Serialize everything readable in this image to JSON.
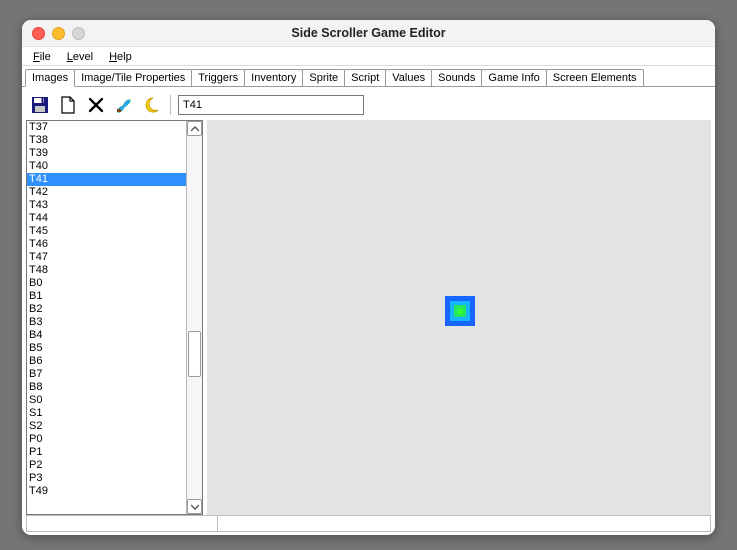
{
  "window": {
    "title": "Side Scroller Game Editor"
  },
  "menubar": {
    "items": [
      "File",
      "Level",
      "Help"
    ]
  },
  "tabs": {
    "items": [
      "Images",
      "Image/Tile Properties",
      "Triggers",
      "Inventory",
      "Sprite",
      "Script",
      "Values",
      "Sounds",
      "Game Info",
      "Screen Elements"
    ],
    "active_index": 0
  },
  "toolbar": {
    "name_field_value": "T41",
    "icons": [
      "save-icon",
      "new-icon",
      "delete-icon",
      "brush-icon",
      "moon-icon"
    ]
  },
  "list": {
    "selected": "T41",
    "items": [
      "T37",
      "T38",
      "T39",
      "T40",
      "T41",
      "T42",
      "T43",
      "T44",
      "T45",
      "T46",
      "T47",
      "T48",
      "B0",
      "B1",
      "B2",
      "B3",
      "B4",
      "B5",
      "B6",
      "B7",
      "B8",
      "S0",
      "S1",
      "S2",
      "P0",
      "P1",
      "P2",
      "P3",
      "T49"
    ]
  },
  "preview": {
    "tile_id": "T41",
    "colors": [
      "#1665ff",
      "#16b6ff",
      "#27e85c",
      "#3bff2d"
    ]
  }
}
